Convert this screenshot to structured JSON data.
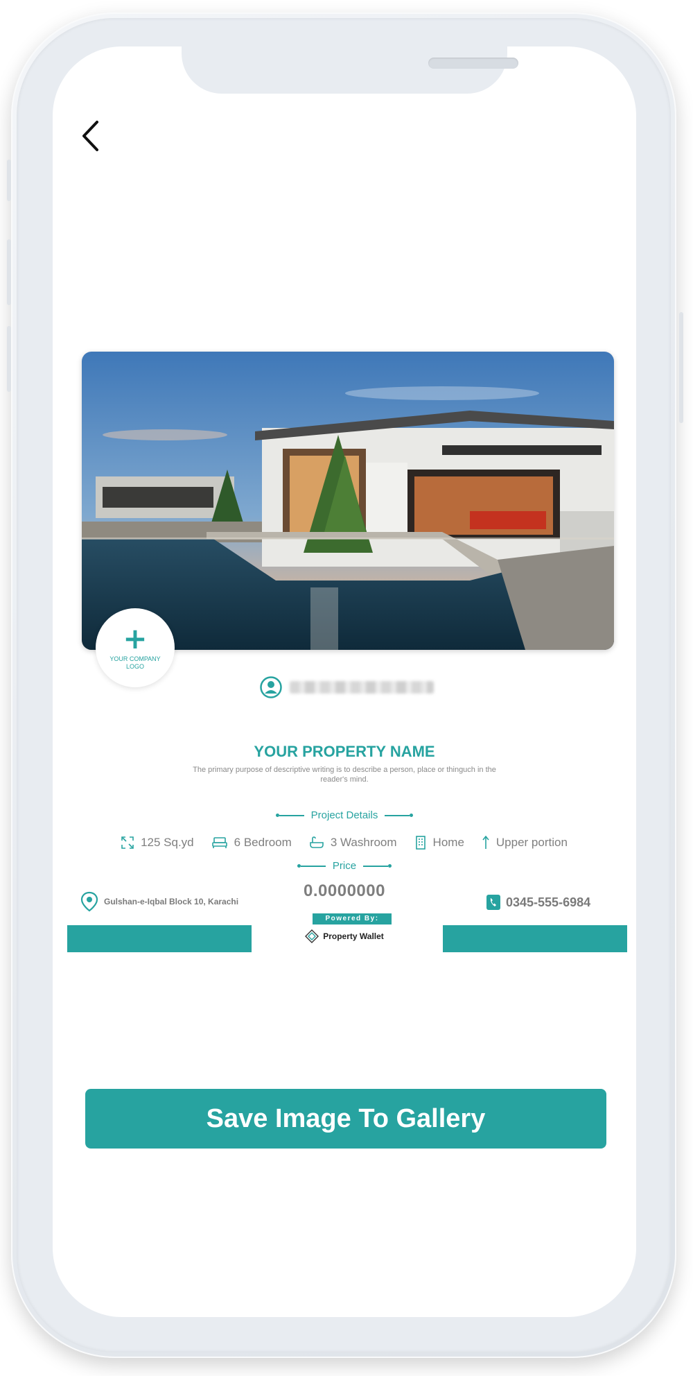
{
  "colors": {
    "accent": "#27a3a0",
    "text_muted": "#7f7f7f",
    "frame": "#e8ecf1"
  },
  "card": {
    "logo_placeholder": "YOUR COMPANY LOGO",
    "property_name": "YOUR PROPERTY NAME",
    "description": "The primary purpose of descriptive writing is to describe a person, place or thinguch  in the reader's mind.",
    "project_details_label": "Project Details",
    "details": [
      {
        "icon": "area-icon",
        "label": "125 Sq.yd"
      },
      {
        "icon": "bed-icon",
        "label": "6 Bedroom"
      },
      {
        "icon": "bathtub-icon",
        "label": "3 Washroom"
      },
      {
        "icon": "building-icon",
        "label": "Home"
      },
      {
        "icon": "arrow-up-icon",
        "label": "Upper portion"
      }
    ],
    "price_label": "Price",
    "price_value": "0.0000000",
    "powered_by": "Powered By:",
    "brand": "Property Wallet",
    "address": "Gulshan-e-Iqbal Block 10, Karachi",
    "phone": "0345-555-6984"
  },
  "actions": {
    "save_label": "Save Image To Gallery"
  }
}
